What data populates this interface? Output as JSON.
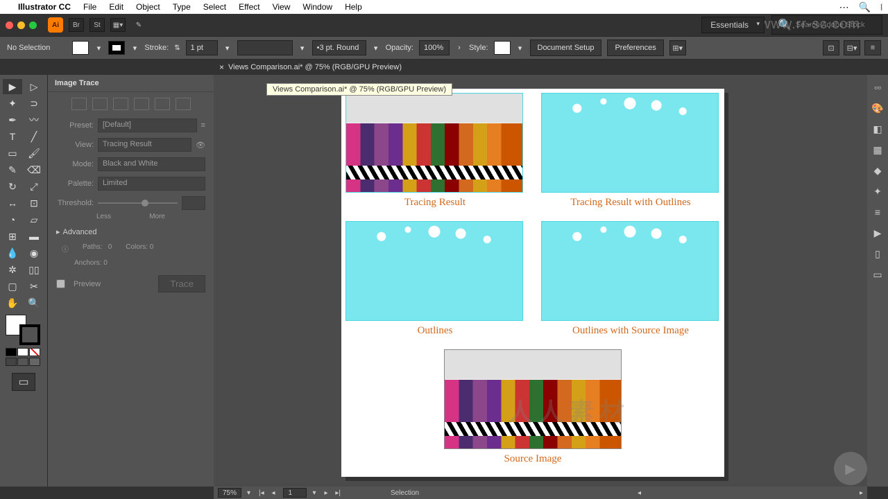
{
  "menubar": {
    "app": "Illustrator CC",
    "items": [
      "File",
      "Edit",
      "Object",
      "Type",
      "Select",
      "Effect",
      "View",
      "Window",
      "Help"
    ]
  },
  "titlebar": {
    "br_label": "Br",
    "st_label": "St",
    "workspace": "Essentials",
    "search_placeholder": "Search Adobe Stock"
  },
  "controlbar": {
    "selection": "No Selection",
    "stroke_label": "Stroke:",
    "stroke_weight": "1 pt",
    "brush_profile": "3 pt. Round",
    "opacity_label": "Opacity:",
    "opacity_value": "100%",
    "style_label": "Style:",
    "doc_setup": "Document Setup",
    "preferences": "Preferences"
  },
  "tab": {
    "title": "Views Comparison.ai* @ 75% (RGB/GPU Preview)"
  },
  "tooltip": {
    "text": "Views Comparison.ai* @ 75% (RGB/GPU Preview)"
  },
  "panel": {
    "title": "Image Trace",
    "preset_label": "Preset:",
    "preset_value": "[Default]",
    "view_label": "View:",
    "view_value": "Tracing Result",
    "mode_label": "Mode:",
    "mode_value": "Black and White",
    "palette_label": "Palette:",
    "palette_value": "Limited",
    "threshold_label": "Threshold:",
    "less": "Less",
    "more": "More",
    "advanced": "Advanced",
    "paths_label": "Paths:",
    "paths_value": "0",
    "colors_label": "Colors:",
    "colors_value": "0",
    "anchors_label": "Anchors:",
    "anchors_value": "0",
    "preview": "Preview",
    "trace": "Trace"
  },
  "canvas": {
    "labels": {
      "tracing_result": "Tracing Result",
      "tracing_outlines": "Tracing Result with Outlines",
      "outlines": "Outlines",
      "outlines_source": "Outlines with Source Image",
      "source": "Source Image"
    }
  },
  "statusbar": {
    "zoom": "75%",
    "artboard": "1",
    "tool": "Selection"
  },
  "watermark": {
    "main": "人人素材",
    "corner": "www.rr-sc.com"
  }
}
